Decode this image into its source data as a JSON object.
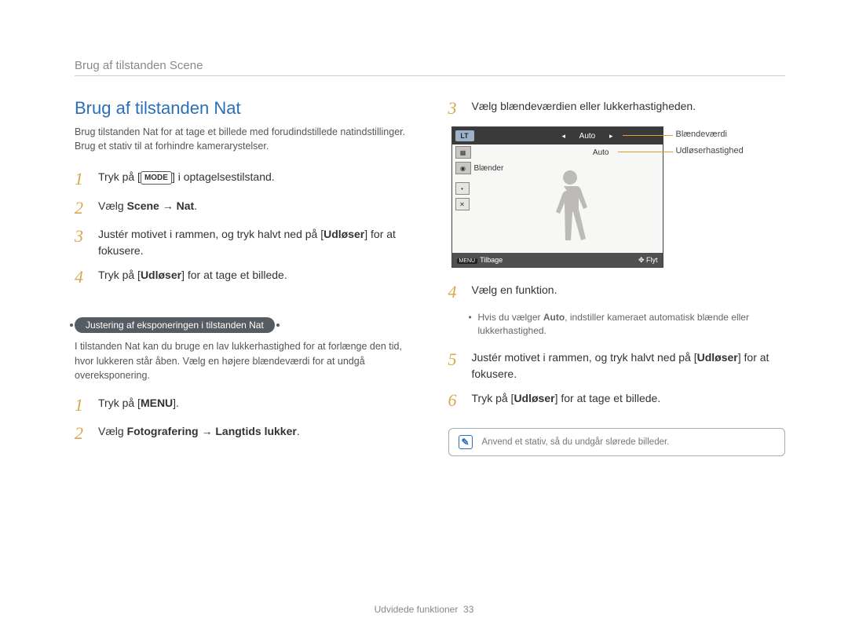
{
  "breadcrumb": "Brug af tilstanden Scene",
  "section_title": "Brug af tilstanden Nat",
  "intro": "Brug tilstanden Nat for at tage et billede med forudindstillede natindstillinger. Brug et stativ til at forhindre kamerarystelser.",
  "steps_left": [
    {
      "num": "1",
      "pre": "Tryk på [",
      "key": "MODE",
      "post": "] i optagelsestilstand."
    },
    {
      "num": "2",
      "text_parts": [
        "Vælg ",
        {
          "b": "Scene"
        },
        " → ",
        {
          "b": "Nat"
        },
        "."
      ]
    },
    {
      "num": "3",
      "text_parts": [
        "Justér motivet i rammen, og tryk halvt ned på [",
        {
          "b": "Udløser"
        },
        "] for at fokusere."
      ]
    },
    {
      "num": "4",
      "text_parts": [
        "Tryk på [",
        {
          "b": "Udløser"
        },
        "] for at tage et billede."
      ]
    }
  ],
  "subsection_title": "Justering af eksponeringen i tilstanden Nat",
  "sub_desc": "I tilstanden Nat kan du bruge en lav lukkerhastighed for at forlænge den tid, hvor lukkeren står åben. Vælg en højere blændeværdi for at undgå overeksponering.",
  "steps_sub": [
    {
      "num": "1",
      "text_parts": [
        "Tryk på [",
        {
          "b": "MENU"
        },
        "]."
      ]
    },
    {
      "num": "2",
      "text_parts": [
        "Vælg ",
        {
          "b": "Fotografering"
        },
        " → ",
        {
          "b": "Langtids lukker"
        },
        "."
      ]
    }
  ],
  "right_step3": {
    "num": "3",
    "text": "Vælg blændeværdien eller lukkerhastigheden."
  },
  "lcd": {
    "lt": "LT",
    "auto1": "Auto",
    "auto2": "Auto",
    "blaender": "Blænder",
    "menu_back": "Tilbage",
    "flyt": "Flyt"
  },
  "callout_top": "Blændeværdi",
  "callout_bottom": "Udløserhastighed",
  "right_step4": {
    "num": "4",
    "text": "Vælg en funktion."
  },
  "right_bullet_parts": [
    "Hvis du vælger ",
    {
      "b": "Auto"
    },
    ", indstiller kameraet automatisk blænde eller lukkerhastighed."
  ],
  "right_step5": {
    "num": "5",
    "text_parts": [
      "Justér motivet i rammen, og tryk halvt ned på [",
      {
        "b": "Udløser"
      },
      "] for at fokusere."
    ]
  },
  "right_step6": {
    "num": "6",
    "text_parts": [
      "Tryk på [",
      {
        "b": "Udløser"
      },
      "] for at tage et billede."
    ]
  },
  "tip": "Anvend et stativ, så du undgår slørede billeder.",
  "footer_label": "Udvidede funktioner",
  "footer_page": "33"
}
